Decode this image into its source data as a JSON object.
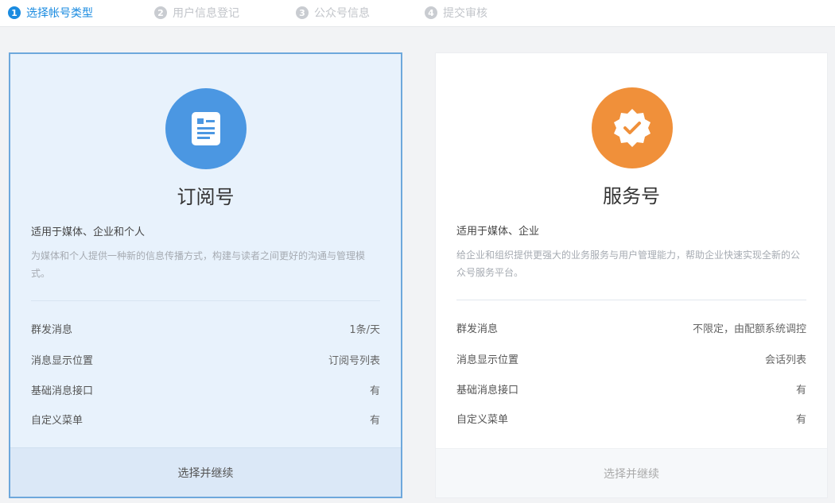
{
  "steps": [
    {
      "num": "1",
      "label": "选择帐号类型"
    },
    {
      "num": "2",
      "label": "用户信息登记"
    },
    {
      "num": "3",
      "label": "公众号信息"
    },
    {
      "num": "4",
      "label": "提交审核"
    }
  ],
  "active_step": 1,
  "colors": {
    "accent": "#1a8be0",
    "subscription_icon_bg": "#4b97e2",
    "service_icon_bg": "#f0903a",
    "selected_card_bg": "#e8f2fc",
    "selected_card_border": "#6ea8dc"
  },
  "cards": [
    {
      "icon": "document-icon",
      "title": "订阅号",
      "subtitle": "适用于媒体、企业和个人",
      "description": "为媒体和个人提供一种新的信息传播方式，构建与读者之间更好的沟通与管理模式。",
      "features": [
        {
          "name": "群发消息",
          "value": "1条/天"
        },
        {
          "name": "消息显示位置",
          "value": "订阅号列表"
        },
        {
          "name": "基础消息接口",
          "value": "有"
        },
        {
          "name": "自定义菜单",
          "value": "有"
        }
      ],
      "button": "选择并继续",
      "selected": true
    },
    {
      "icon": "verified-badge-icon",
      "title": "服务号",
      "subtitle": "适用于媒体、企业",
      "description": "给企业和组织提供更强大的业务服务与用户管理能力，帮助企业快速实现全新的公众号服务平台。",
      "features": [
        {
          "name": "群发消息",
          "value": "不限定，由配额系统调控"
        },
        {
          "name": "消息显示位置",
          "value": "会话列表"
        },
        {
          "name": "基础消息接口",
          "value": "有"
        },
        {
          "name": "自定义菜单",
          "value": "有"
        }
      ],
      "button": "选择并继续",
      "selected": false
    }
  ]
}
